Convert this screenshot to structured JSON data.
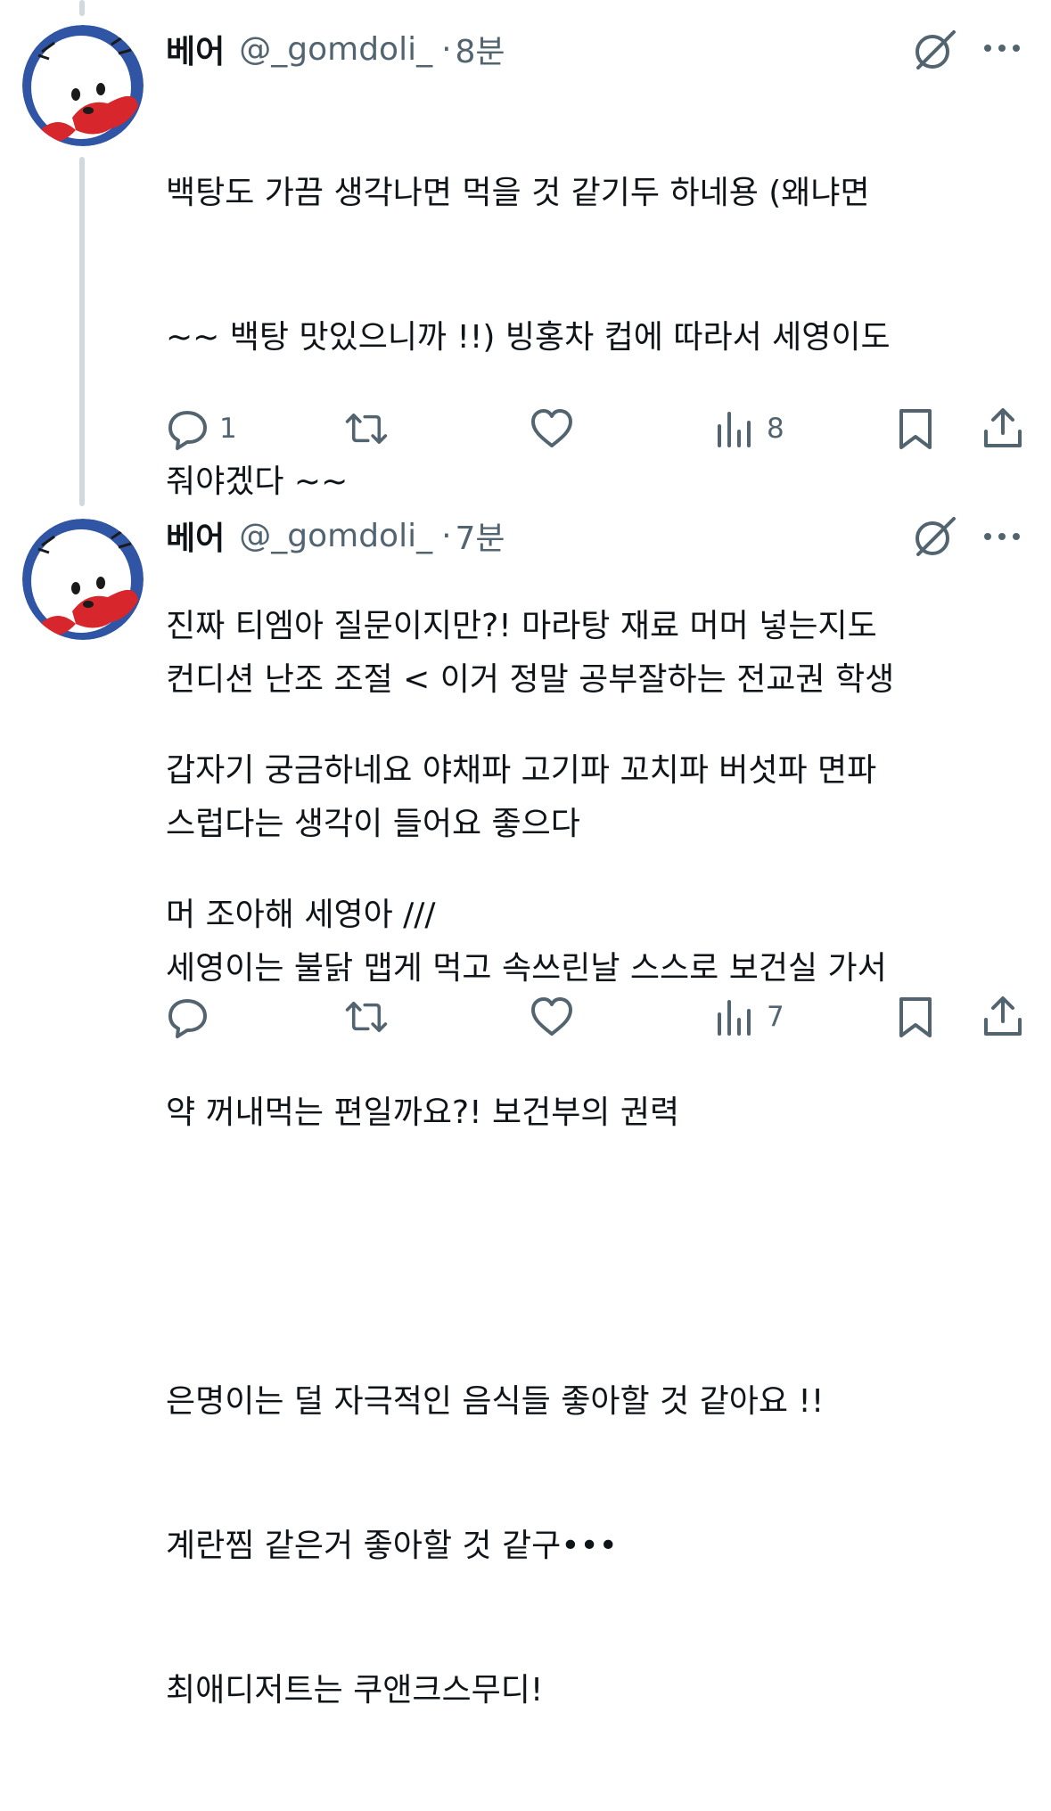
{
  "colors": {
    "text": "#0f1419",
    "secondary": "#536471",
    "thread_line": "#cfd9de",
    "avatar_ring": "#2f55a4",
    "avatar_scarf": "#d7262c"
  },
  "tweets": [
    {
      "name": "베어",
      "handle": "@_gomdoli_",
      "separator": "·",
      "time": "8분",
      "lines": [
        "백탕도 가끔 생각나면 먹을 것 같기두 하네용 (왜냐면",
        "~~ 백탕 맛있으니까 !!) 빙홍차 컵에 따라서 세영이도",
        "줘야겠다 ~~",
        "진짜 티엠아 질문이지만?! 마라탕 재료 머머 넣는지도",
        "갑자기 궁금하네요 야채파 고기파 꼬치파 버섯파 면파",
        "머 조아해 세영아 ///"
      ],
      "reply_count": "1",
      "retweet_count": "",
      "like_count": "",
      "view_count": "8",
      "icons": [
        "grok-icon",
        "more-icon",
        "reply-icon",
        "retweet-icon",
        "like-icon",
        "views-icon",
        "bookmark-icon",
        "share-icon"
      ]
    },
    {
      "name": "베어",
      "handle": "@_gomdoli_",
      "separator": "·",
      "time": "7분",
      "lines": [
        "컨디션 난조 조절 < 이거 정말 공부잘하는 전교권 학생",
        "스럽다는 생각이 들어요 좋으다",
        "세영이는 불닭 맵게 먹고 속쓰린날 스스로 보건실 가서",
        "약 꺼내먹는 편일까요?! 보건부의 권력",
        "",
        "은명이는 덜 자극적인 음식들 좋아할 것 같아요 !!",
        "계란찜 같은거 좋아할 것 같구•••",
        "최애디저트는 쿠앤크스무디!"
      ],
      "reply_count": "",
      "retweet_count": "",
      "like_count": "",
      "view_count": "7",
      "icons": [
        "grok-icon",
        "more-icon",
        "reply-icon",
        "retweet-icon",
        "like-icon",
        "views-icon",
        "bookmark-icon",
        "share-icon"
      ]
    }
  ]
}
